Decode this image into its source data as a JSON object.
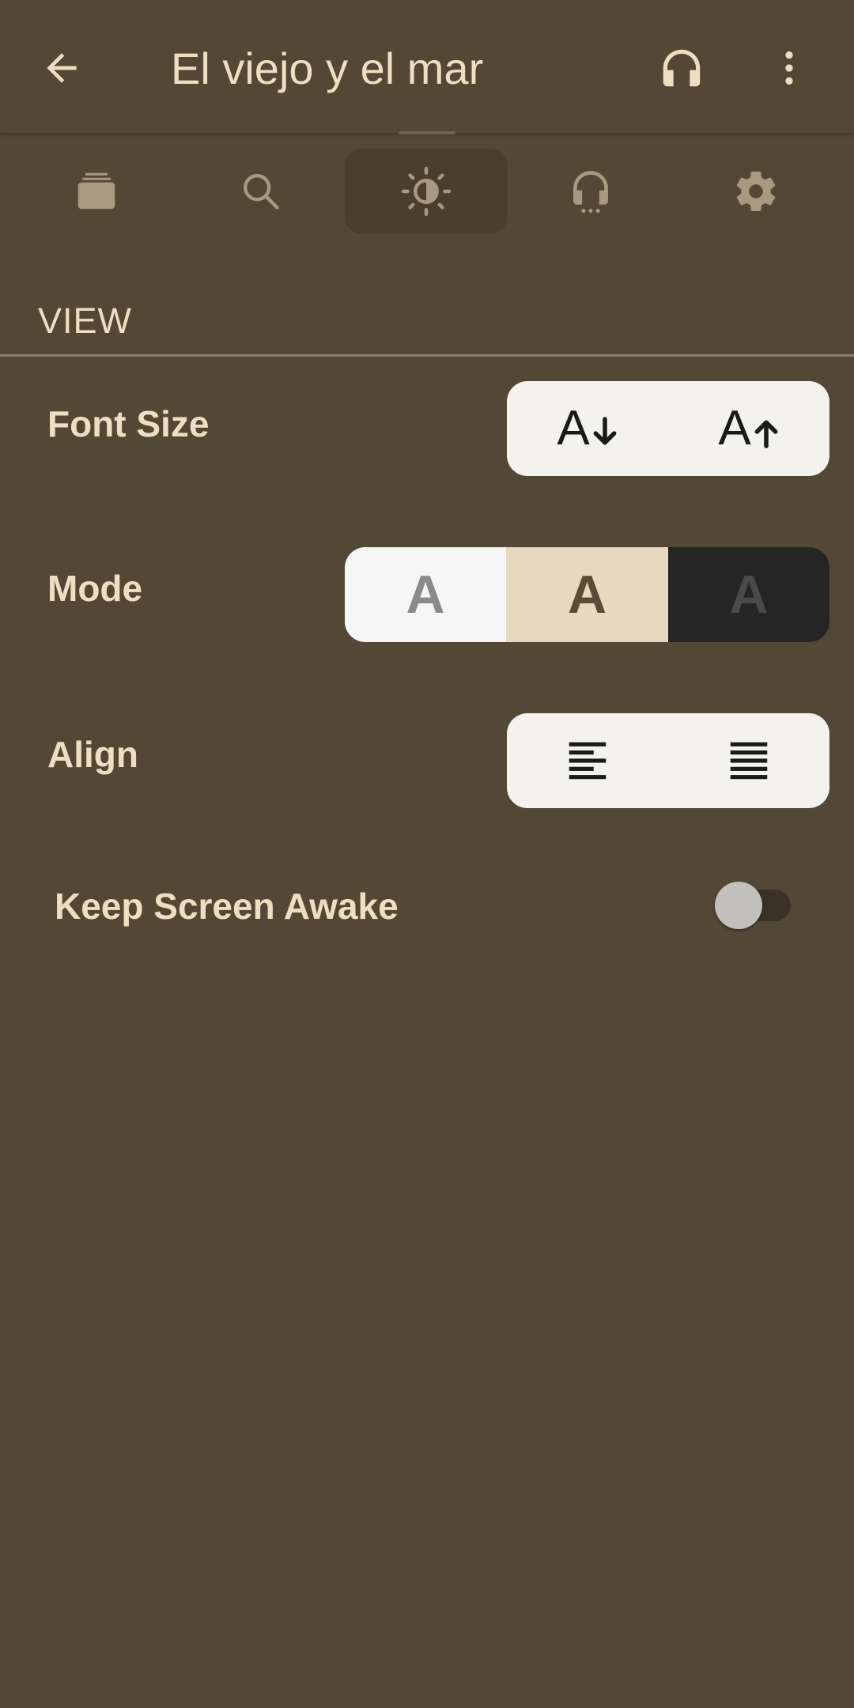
{
  "appbar": {
    "title": "El viejo y el mar",
    "back_icon": "arrow-left-icon",
    "headphones_icon": "headphones-icon",
    "more_icon": "more-vertical-icon"
  },
  "tabs": [
    {
      "icon": "library-icon",
      "active": false
    },
    {
      "icon": "search-icon",
      "active": false
    },
    {
      "icon": "brightness-contrast-icon",
      "active": true
    },
    {
      "icon": "headphones-dots-icon",
      "active": false
    },
    {
      "icon": "settings-gear-icon",
      "active": false
    }
  ],
  "view": {
    "section_title": "VIEW",
    "font_size": {
      "label": "Font Size",
      "decrease_glyph": "A",
      "increase_glyph": "A"
    },
    "mode": {
      "label": "Mode",
      "options": [
        {
          "glyph": "A",
          "name": "light"
        },
        {
          "glyph": "A",
          "name": "sepia",
          "selected": true
        },
        {
          "glyph": "A",
          "name": "dark"
        }
      ]
    },
    "align": {
      "label": "Align",
      "options": [
        "align-left-icon",
        "align-justify-icon"
      ]
    },
    "keep_awake": {
      "label": "Keep Screen Awake",
      "enabled": false
    }
  },
  "colors": {
    "background": "#534735",
    "text": "#efdfc2",
    "active_tab": "#4a3f2f",
    "icon_muted": "#a89a80",
    "segment_light": "#f3f2ec",
    "mode_sepia": "#e8d8bd",
    "mode_dark": "#252525"
  }
}
